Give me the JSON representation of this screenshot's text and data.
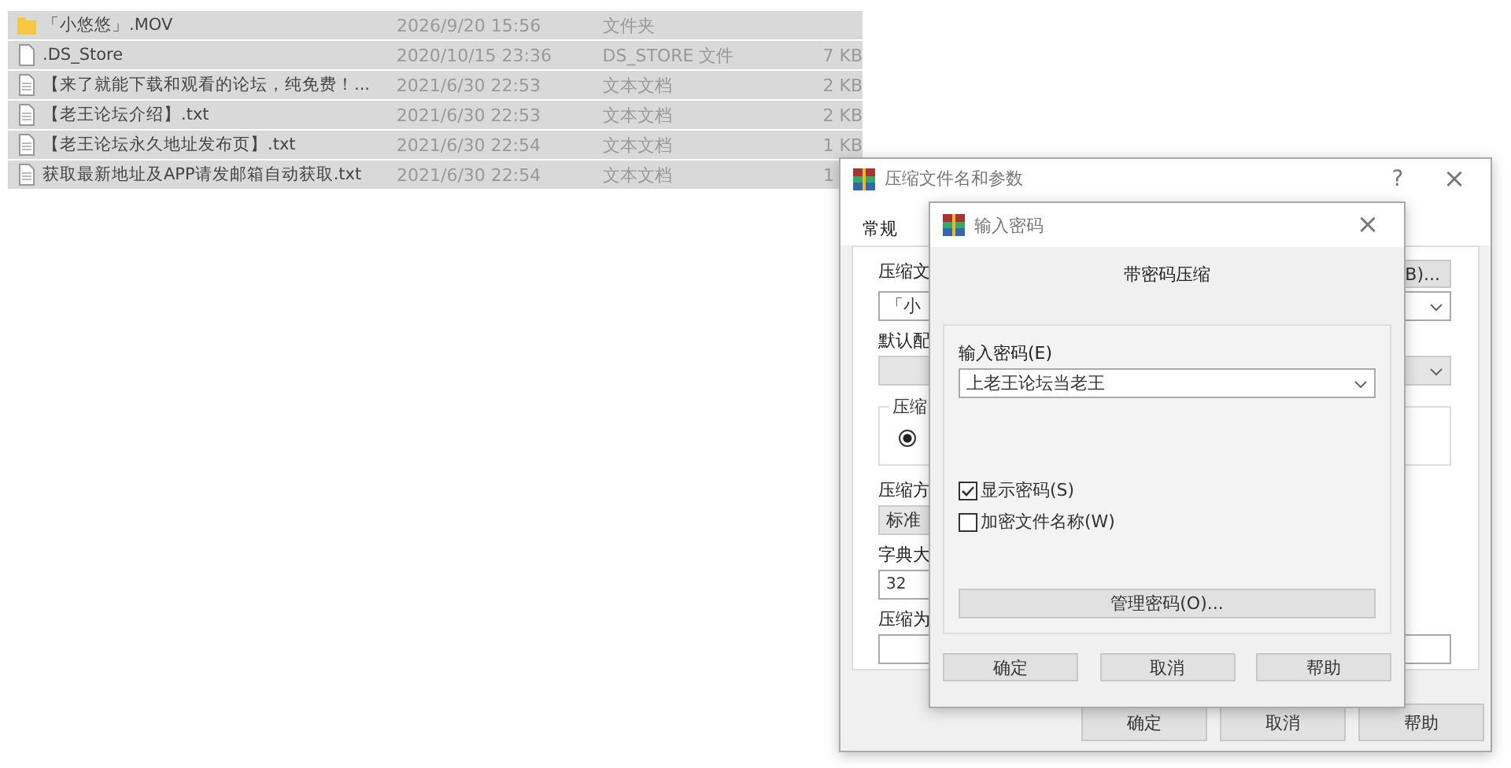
{
  "files": [
    {
      "kind": "folder",
      "name": "「小悠悠」.MOV",
      "date": "2026/9/20 15:56",
      "type": "文件夹",
      "selected": true
    },
    {
      "kind": "file",
      "name": ".DS_Store",
      "date": "2020/10/15 23:36",
      "type": "DS_STORE 文件",
      "size": "7 KB",
      "selected": true
    },
    {
      "kind": "text",
      "name": "【来了就能下载和观看的论坛，纯免费！...",
      "date": "2021/6/30 22:53",
      "type": "文本文档",
      "size": "2 KB",
      "selected": true
    },
    {
      "kind": "text",
      "name": "【老王论坛介绍】.txt",
      "date": "2021/6/30 22:53",
      "type": "文本文档",
      "size": "2 KB",
      "selected": true
    },
    {
      "kind": "text",
      "name": "【老王论坛永久地址发布页】.txt",
      "date": "2021/6/30 22:54",
      "type": "文本文档",
      "size": "1 KB",
      "selected": true
    },
    {
      "kind": "text",
      "name": "获取最新地址及APP请发邮箱自动获取.txt",
      "date": "2021/6/30 22:54",
      "type": "文本文档",
      "size": "1",
      "selected": true
    }
  ],
  "archive_dialog": {
    "title": "压缩文件名和参数",
    "help": "?",
    "close": "×",
    "tabs": [
      {
        "label": "常规",
        "selected": true
      }
    ],
    "name_label": "压缩文",
    "browse_button": "B)...",
    "name_value": "「小",
    "profile_label": "默认配",
    "group_label": "压缩",
    "radio_selected": true,
    "method_label": "压缩方",
    "method_value": "标准",
    "dict_label": "字典大",
    "dict_value": "32",
    "split_label": "压缩为",
    "buttons": [
      "确定",
      "取消",
      "帮助"
    ]
  },
  "password_dialog": {
    "title": "输入密码",
    "close": "×",
    "heading": "带密码压缩",
    "password_label": "输入密码(E)",
    "password_value": "上老王论坛当老王",
    "checkboxes": [
      {
        "label": "显示密码(S)",
        "checked": true
      },
      {
        "label": "加密文件名称(W)",
        "checked": false
      }
    ],
    "manage_button": "管理密码(O)...",
    "buttons": [
      "确定",
      "取消",
      "帮助"
    ]
  }
}
